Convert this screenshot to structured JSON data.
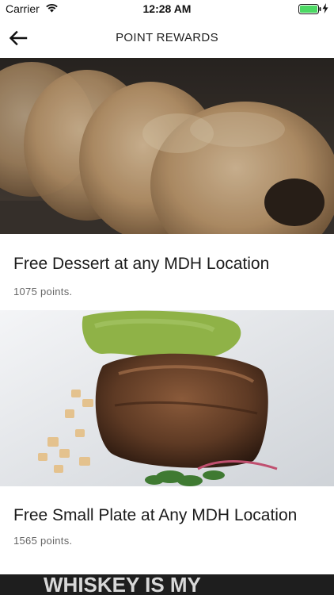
{
  "status_bar": {
    "carrier": "Carrier",
    "time": "12:28 AM",
    "battery_color": "#4cd964"
  },
  "nav": {
    "title": "POINT REWARDS",
    "back_icon": "arrow-left-icon"
  },
  "rewards": [
    {
      "title": "Free Dessert at any MDH Location",
      "points": "1075 points.",
      "image": "sugar-donuts-photo"
    },
    {
      "title": "Free Small Plate at Any MDH Location",
      "points": "1565 points.",
      "image": "braised-meat-with-avocado-puree-photo"
    },
    {
      "title": "",
      "points": "",
      "image": "whiskey-sign-photo"
    }
  ],
  "partial_banner_text": "WHISKEY IS MY"
}
